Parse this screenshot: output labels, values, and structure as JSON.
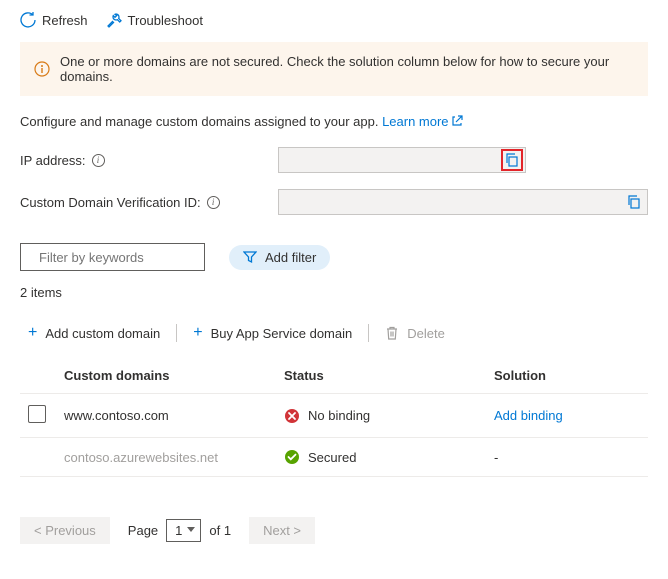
{
  "toolbar": {
    "refresh": "Refresh",
    "troubleshoot": "Troubleshoot"
  },
  "alert": {
    "text": "One or more domains are not secured. Check the solution column below for how to secure your domains."
  },
  "description": {
    "text": "Configure and manage custom domains assigned to your app. ",
    "link": "Learn more"
  },
  "form": {
    "ip_label": "IP address:",
    "ip_value": "",
    "verification_label": "Custom Domain Verification ID:",
    "verification_value": ""
  },
  "filters": {
    "search_placeholder": "Filter by keywords",
    "add_filter": "Add filter"
  },
  "count_text": "2 items",
  "actions": {
    "add_domain": "Add custom domain",
    "buy_domain": "Buy App Service domain",
    "delete": "Delete"
  },
  "table": {
    "headers": {
      "domain": "Custom domains",
      "status": "Status",
      "solution": "Solution"
    },
    "rows": [
      {
        "domain": "www.contoso.com",
        "status": "No binding",
        "status_ok": false,
        "solution": "Add binding",
        "selectable": true,
        "muted": false
      },
      {
        "domain": "contoso.azurewebsites.net",
        "status": "Secured",
        "status_ok": true,
        "solution": "-",
        "selectable": false,
        "muted": true
      }
    ]
  },
  "pagination": {
    "prev": "< Previous",
    "page_label": "Page",
    "current": "1",
    "of_text": "of 1",
    "next": "Next >"
  }
}
